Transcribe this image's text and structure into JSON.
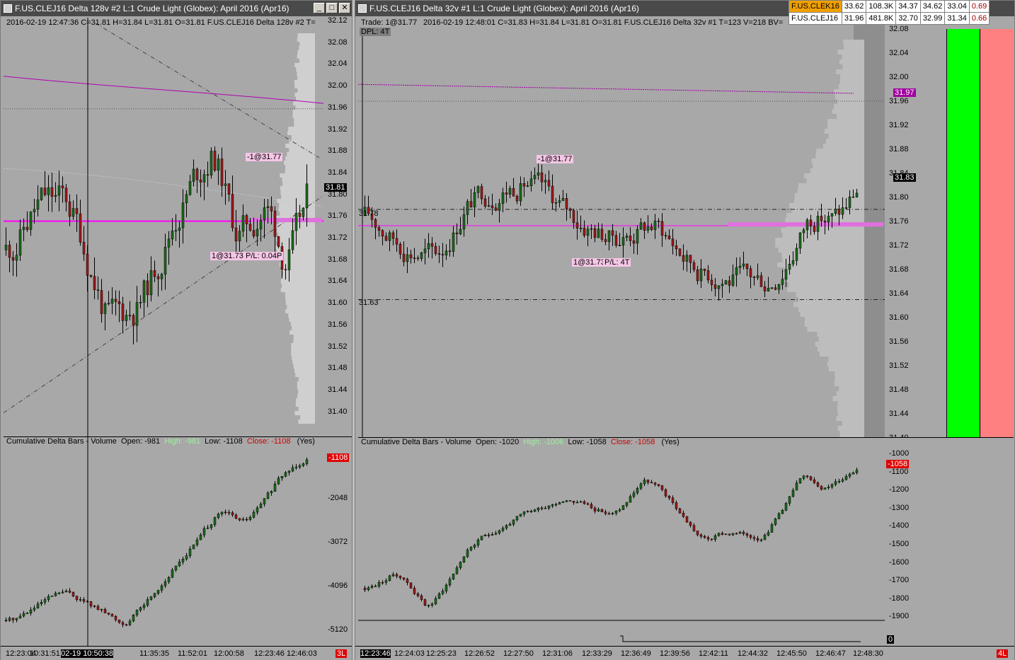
{
  "left_window": {
    "title": "F.US.CLEJ16  Delta 128v  #2  L:1  Crude Light (Globex): April 2016 (Apr16)",
    "info_line": "2016-02-19 12:47:36  C=31.81 H=31.84 L=31.81 O=31.81 F.US.CLEJ16  Delta 128v  #2 T=",
    "price_ticks": [
      "32.12",
      "32.08",
      "32.04",
      "32.00",
      "31.96",
      "31.92",
      "31.88",
      "31.84",
      "31.80",
      "31.76",
      "31.72",
      "31.68",
      "31.64",
      "31.60",
      "31.56",
      "31.52",
      "31.48",
      "31.44",
      "31.40"
    ],
    "last_price": "31.81",
    "order_label_1": "-1@31.77",
    "order_label_2": "1@31.73",
    "pl_label": "P/L: 0.04P",
    "cd_header": {
      "title": "Cumulative Delta Bars - Volume",
      "open_label": "Open:",
      "open": "-981",
      "high_label": "High:",
      "high": "-981",
      "low_label": "Low:",
      "low": "-1108",
      "close_label": "Close:",
      "close": "-1108",
      "flag": "(Yes)"
    },
    "cd_ticks": [
      "-1108",
      "-2048",
      "-3072",
      "-4096",
      "-5120"
    ],
    "time_ticks": [
      "12:23:04",
      "10:31:51",
      "02-19  10:50:38",
      "11:35:35",
      "11:52:01",
      "12:00:58",
      "12:23:46",
      "12:46:03"
    ],
    "corner_badge": "3L"
  },
  "right_window": {
    "title": "F.US.CLEJ16  Delta 32v  #1  L:1  Crude Light (Globex): April 2016 (Apr16)",
    "trade_line": "Trade: 1@31.77",
    "info_line": "2016-02-19 12:48:01  C=31.83 H=31.84 L=31.81 O=31.81 F.US.CLEJ16  Delta 32v  #1 T=123 V=218 BV=",
    "dpl_label": "DPL: 4T",
    "price_ticks": [
      "32.08",
      "32.04",
      "32.00",
      "31.96",
      "31.92",
      "31.88",
      "31.84",
      "31.80",
      "31.76",
      "31.72",
      "31.68",
      "31.64",
      "31.60",
      "31.56",
      "31.52",
      "31.48",
      "31.44",
      "31.40"
    ],
    "last_price": "31.83",
    "purple_price": "31.97",
    "level_high": "31.78",
    "level_low": "31.63",
    "order_label_1": "-1@31.77",
    "order_label_2": "1@31.73",
    "pl_label": "P/L: 4T",
    "cd_header": {
      "title": "Cumulative Delta Bars - Volume",
      "open_label": "Open:",
      "open": "-1020",
      "high_label": "High:",
      "high": "-1006",
      "low_label": "Low:",
      "low": "-1058",
      "close_label": "Close:",
      "close": "-1058",
      "flag": "(Yes)"
    },
    "cd_ticks": [
      "-1000",
      "-1100",
      "-1200",
      "-1300",
      "-1400",
      "-1500",
      "-1600",
      "-1700",
      "-1800",
      "-1900"
    ],
    "cd_last": "-1058",
    "zero_label": "0",
    "time_ticks": [
      "12:23:46",
      "12:24:03",
      "12:25:23",
      "12:26:52",
      "12:27:50",
      "12:31:06",
      "12:33:29",
      "12:36:49",
      "12:39:56",
      "12:42:11",
      "12:44:32",
      "12:45:50",
      "12:46:47",
      "12:48:30"
    ],
    "corner_badge": "4L"
  },
  "quote_table": {
    "rows": [
      [
        "F.US.CLEK16",
        "33.62",
        "108.3K",
        "34.37",
        "34.62",
        "33.04",
        "0.69"
      ],
      [
        "F.US.CLEJ16",
        "31.96",
        "481.8K",
        "32.70",
        "32.99",
        "31.34",
        "0.66"
      ]
    ]
  },
  "colors": {
    "bg": "#a8a8a8",
    "up": "#1a6b1a",
    "down": "#a01818",
    "magenta": "#ff00ff",
    "buy_bar": "#00ff00",
    "sell_bar": "#ff8080",
    "profile": "#cfcfcf"
  }
}
